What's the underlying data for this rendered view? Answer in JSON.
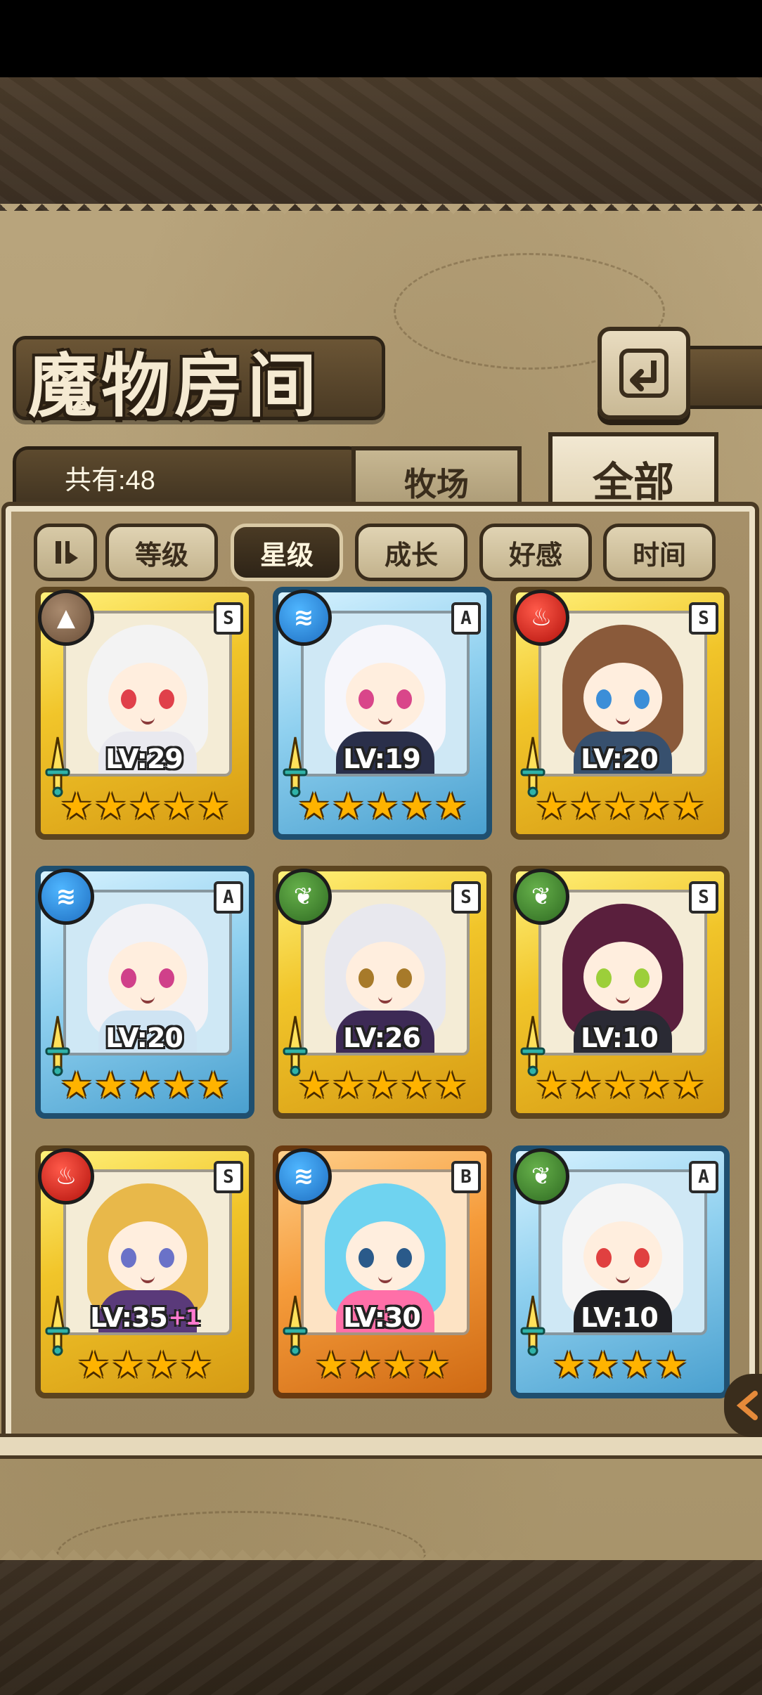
{
  "title": "魔物房间",
  "count_label": "共有:48",
  "tabs": {
    "ranch": "牧场",
    "all": "全部"
  },
  "sort": {
    "level": "等级",
    "star": "星级",
    "growth": "成长",
    "favor": "好感",
    "time": "时间",
    "active": "星级"
  },
  "icons": {
    "back": "back-arrow-icon",
    "sort_toggle": "sort-order-icon",
    "side": "side-arrow-icon"
  },
  "colors": {
    "rank_S": "#f1c52a",
    "rank_A": "#8fd0ef",
    "rank_B": "#f59b3a",
    "star": "#ffb300"
  },
  "monsters": [
    {
      "rank": "S",
      "element": "earth",
      "level": "LV:29",
      "bonus": "",
      "stars": 5,
      "hair": "#f3f3f3",
      "eyes": "#e0404a",
      "outfit": "#e9e9ef"
    },
    {
      "rank": "A",
      "element": "water",
      "level": "LV:19",
      "bonus": "",
      "stars": 5,
      "hair": "#f6f6fb",
      "eyes": "#d9468a",
      "outfit": "#2a2f4a"
    },
    {
      "rank": "S",
      "element": "fire",
      "level": "LV:20",
      "bonus": "",
      "stars": 5,
      "hair": "#8a5a3a",
      "eyes": "#3b8ed8",
      "outfit": "#37506e"
    },
    {
      "rank": "A",
      "element": "water",
      "level": "LV:20",
      "bonus": "",
      "stars": 5,
      "hair": "#f2f2f6",
      "eyes": "#d0408a",
      "outfit": "#cfe4f3"
    },
    {
      "rank": "S",
      "element": "wood",
      "level": "LV:26",
      "bonus": "",
      "stars": 5,
      "hair": "#e8e8ee",
      "eyes": "#a77a2a",
      "outfit": "#3d2a55"
    },
    {
      "rank": "S",
      "element": "wood",
      "level": "LV:10",
      "bonus": "",
      "stars": 5,
      "hair": "#5a1f3d",
      "eyes": "#9ccf3a",
      "outfit": "#2a2a34"
    },
    {
      "rank": "S",
      "element": "fire",
      "level": "LV:35",
      "bonus": "+1",
      "stars": 4,
      "hair": "#e8b84a",
      "eyes": "#6a72c8",
      "outfit": "#5a3a7a"
    },
    {
      "rank": "B",
      "element": "water",
      "level": "LV:30",
      "bonus": "",
      "stars": 4,
      "hair": "#6fd3f0",
      "eyes": "#2a5a8a",
      "outfit": "#ff6fa8"
    },
    {
      "rank": "A",
      "element": "wood",
      "level": "LV:10",
      "bonus": "",
      "stars": 4,
      "hair": "#f5f5f5",
      "eyes": "#e04040",
      "outfit": "#1f1f24"
    }
  ]
}
